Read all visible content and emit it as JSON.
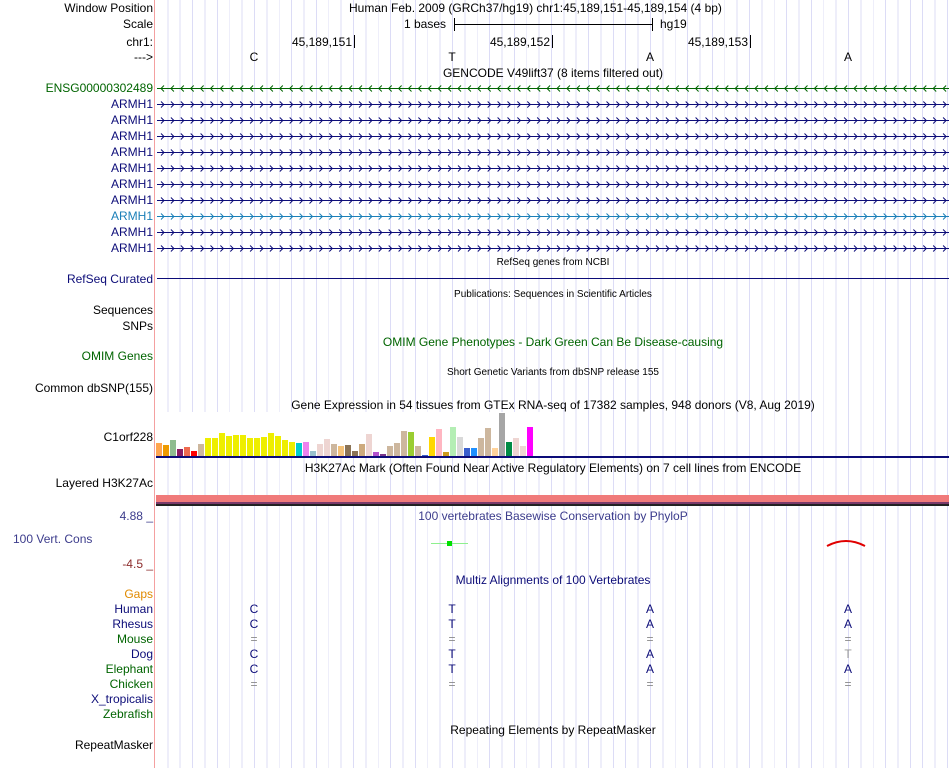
{
  "header": {
    "window_position_label": "Window Position",
    "window_position_value": "Human Feb. 2009 (GRCh37/hg19)   chr1:45,189,151-45,189,154 (4 bp)",
    "scale_label": "Scale",
    "scale_value": "1 bases",
    "scale_assembly": "hg19",
    "chrom_label": "chr1:",
    "positions": [
      "45,189,151",
      "45,189,152",
      "45,189,153"
    ],
    "strand_label": "--->",
    "bases": [
      "C",
      "T",
      "A",
      "A"
    ]
  },
  "gencode": {
    "title": "GENCODE V49lift37 (8 items filtered out)",
    "items": [
      {
        "label": "ENSG00000302489",
        "strand": "-",
        "color": "#006400"
      },
      {
        "label": "ARMH1",
        "strand": "+",
        "color": "#0c0c78"
      },
      {
        "label": "ARMH1",
        "strand": "+",
        "color": "#0c0c78"
      },
      {
        "label": "ARMH1",
        "strand": "+",
        "color": "#0c0c78"
      },
      {
        "label": "ARMH1",
        "strand": "+",
        "color": "#0c0c78"
      },
      {
        "label": "ARMH1",
        "strand": "+",
        "color": "#0c0c78"
      },
      {
        "label": "ARMH1",
        "strand": "+",
        "color": "#0c0c78"
      },
      {
        "label": "ARMH1",
        "strand": "+",
        "color": "#0c0c78"
      },
      {
        "label": "ARMH1",
        "strand": "+",
        "color": "#1a7fb8"
      },
      {
        "label": "ARMH1",
        "strand": "+",
        "color": "#0c0c78"
      },
      {
        "label": "ARMH1",
        "strand": "+",
        "color": "#0c0c78"
      }
    ]
  },
  "refseq": {
    "title": "RefSeq genes from NCBI",
    "label": "RefSeq Curated"
  },
  "publications": {
    "title": "Publications: Sequences in Scientific Articles",
    "label": "Sequences"
  },
  "snps": {
    "label": "SNPs"
  },
  "omim": {
    "title": "OMIM Gene Phenotypes - Dark Green Can Be Disease-causing",
    "label": "OMIM Genes"
  },
  "dbsnp": {
    "title": "Short Genetic Variants from dbSNP release 155",
    "label": "Common dbSNP(155)"
  },
  "gtex": {
    "title": "Gene Expression in 54 tissues from GTEx RNA-seq of 17382 samples, 948 donors (V8, Aug 2019)",
    "label": "C1orf228",
    "relative_expression": [
      0.3,
      0.26,
      0.37,
      0.16,
      0.21,
      0.12,
      0.28,
      0.42,
      0.42,
      0.53,
      0.47,
      0.49,
      0.49,
      0.42,
      0.42,
      0.44,
      0.53,
      0.47,
      0.37,
      0.33,
      0.3,
      0.33,
      0.12,
      0.28,
      0.4,
      0.28,
      0.23,
      0.26,
      0.12,
      0.28,
      0.51,
      0.09,
      0.05,
      0.23,
      0.3,
      0.58,
      0.56,
      0.23,
      0.03,
      0.44,
      0.63,
      0.09,
      0.67,
      0.44,
      0.19,
      0.19,
      0.42,
      0.65,
      0.19,
      1.0,
      0.33,
      0.42,
      0.23,
      0.67
    ],
    "colors": [
      "#ffa54f",
      "#ee9a00",
      "#8fbc8f",
      "#8b1c62",
      "#ee6a50",
      "#ff0000",
      "#cdb79e",
      "#eeee00",
      "#eeee00",
      "#eeee00",
      "#eeee00",
      "#eeee00",
      "#eeee00",
      "#eeee00",
      "#eeee00",
      "#eeee00",
      "#eeee00",
      "#eeee00",
      "#eeee00",
      "#eeee00",
      "#00cdcd",
      "#ee82ee",
      "#9ac0cd",
      "#eed5d2",
      "#eed5d2",
      "#cdb79e",
      "#f4c27a",
      "#8b7355",
      "#8b7355",
      "#cdaa7d",
      "#eed5d2",
      "#b452cd",
      "#7a378b",
      "#cdb79e",
      "#cdb79e",
      "#cdb79e",
      "#9acd32",
      "#cdb79e",
      "#3a5fcd",
      "#ffd700",
      "#ffb6c1",
      "#cd9b1d",
      "#b4eeb4",
      "#d9d9d9",
      "#3a5fcd",
      "#1e90ff",
      "#cdb79e",
      "#cdb79e",
      "#ffd39b",
      "#a6a6a6",
      "#008b45",
      "#eed5d2",
      "#eed5d2",
      "#ff00ff"
    ]
  },
  "h3k27ac": {
    "title": "H3K27Ac Mark (Often Found Near Active Regulatory Elements) on 7 cell lines from ENCODE",
    "label": "Layered H3K27Ac"
  },
  "phylop": {
    "title": "100 vertebrates Basewise Conservation by PhyloP",
    "label": "100 Vert. Cons",
    "max": "4.88 _",
    "min": "-4.5 _"
  },
  "multiz": {
    "title": "Multiz Alignments of 100 Vertebrates",
    "gaps_label": "Gaps",
    "species": [
      {
        "label": "Human",
        "color": "#0c0c78",
        "bases": [
          "C",
          "T",
          "A",
          "A"
        ]
      },
      {
        "label": "Rhesus",
        "color": "#0c0c78",
        "bases": [
          "C",
          "T",
          "A",
          "A"
        ]
      },
      {
        "label": "Mouse",
        "color": "#006400",
        "bases": [
          "=",
          "=",
          "=",
          "="
        ]
      },
      {
        "label": "Dog",
        "color": "#0c0c78",
        "bases": [
          "C",
          "T",
          "A",
          "T"
        ]
      },
      {
        "label": "Elephant",
        "color": "#006400",
        "bases": [
          "C",
          "T",
          "A",
          "A"
        ]
      },
      {
        "label": "Chicken",
        "color": "#006400",
        "bases": [
          "=",
          "=",
          "=",
          "="
        ]
      },
      {
        "label": "X_tropicalis",
        "color": "#0c0c78",
        "bases": []
      },
      {
        "label": "Zebrafish",
        "color": "#006400",
        "bases": []
      }
    ]
  },
  "repeatmasker": {
    "title": "Repeating Elements by RepeatMasker",
    "label": "RepeatMasker"
  }
}
